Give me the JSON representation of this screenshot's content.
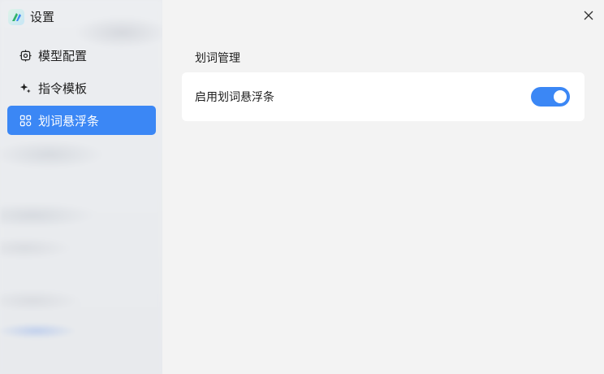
{
  "window": {
    "title": "设置",
    "app_icon": "app-logo-icon",
    "close_icon": "close-icon"
  },
  "sidebar": {
    "items": [
      {
        "label": "模型配置",
        "icon": "model-chip-icon",
        "active": false
      },
      {
        "label": "指令模板",
        "icon": "sparkle-icon",
        "active": false
      },
      {
        "label": "划词悬浮条",
        "icon": "grid-icon",
        "active": true
      }
    ]
  },
  "main": {
    "section_title": "划词管理",
    "settings": [
      {
        "label": "启用划词悬浮条",
        "enabled": true
      }
    ]
  },
  "colors": {
    "accent": "#3b87f5",
    "sidebar_bg": "#e9ebee",
    "main_bg": "#f3f3f3",
    "card_bg": "#ffffff"
  }
}
